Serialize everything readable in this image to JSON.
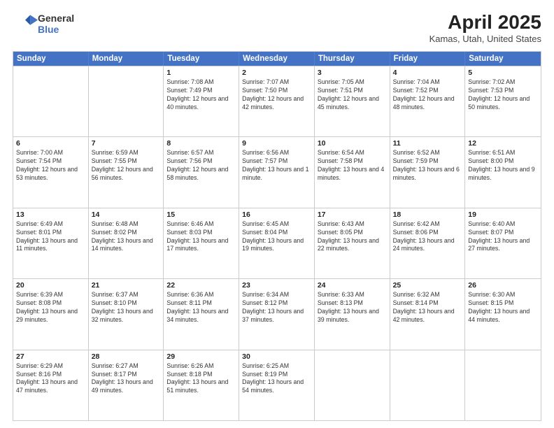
{
  "header": {
    "logo_general": "General",
    "logo_blue": "Blue",
    "month_year": "April 2025",
    "location": "Kamas, Utah, United States"
  },
  "days_of_week": [
    "Sunday",
    "Monday",
    "Tuesday",
    "Wednesday",
    "Thursday",
    "Friday",
    "Saturday"
  ],
  "weeks": [
    [
      {
        "day": "",
        "info": ""
      },
      {
        "day": "",
        "info": ""
      },
      {
        "day": "1",
        "info": "Sunrise: 7:08 AM\nSunset: 7:49 PM\nDaylight: 12 hours and 40 minutes."
      },
      {
        "day": "2",
        "info": "Sunrise: 7:07 AM\nSunset: 7:50 PM\nDaylight: 12 hours and 42 minutes."
      },
      {
        "day": "3",
        "info": "Sunrise: 7:05 AM\nSunset: 7:51 PM\nDaylight: 12 hours and 45 minutes."
      },
      {
        "day": "4",
        "info": "Sunrise: 7:04 AM\nSunset: 7:52 PM\nDaylight: 12 hours and 48 minutes."
      },
      {
        "day": "5",
        "info": "Sunrise: 7:02 AM\nSunset: 7:53 PM\nDaylight: 12 hours and 50 minutes."
      }
    ],
    [
      {
        "day": "6",
        "info": "Sunrise: 7:00 AM\nSunset: 7:54 PM\nDaylight: 12 hours and 53 minutes."
      },
      {
        "day": "7",
        "info": "Sunrise: 6:59 AM\nSunset: 7:55 PM\nDaylight: 12 hours and 56 minutes."
      },
      {
        "day": "8",
        "info": "Sunrise: 6:57 AM\nSunset: 7:56 PM\nDaylight: 12 hours and 58 minutes."
      },
      {
        "day": "9",
        "info": "Sunrise: 6:56 AM\nSunset: 7:57 PM\nDaylight: 13 hours and 1 minute."
      },
      {
        "day": "10",
        "info": "Sunrise: 6:54 AM\nSunset: 7:58 PM\nDaylight: 13 hours and 4 minutes."
      },
      {
        "day": "11",
        "info": "Sunrise: 6:52 AM\nSunset: 7:59 PM\nDaylight: 13 hours and 6 minutes."
      },
      {
        "day": "12",
        "info": "Sunrise: 6:51 AM\nSunset: 8:00 PM\nDaylight: 13 hours and 9 minutes."
      }
    ],
    [
      {
        "day": "13",
        "info": "Sunrise: 6:49 AM\nSunset: 8:01 PM\nDaylight: 13 hours and 11 minutes."
      },
      {
        "day": "14",
        "info": "Sunrise: 6:48 AM\nSunset: 8:02 PM\nDaylight: 13 hours and 14 minutes."
      },
      {
        "day": "15",
        "info": "Sunrise: 6:46 AM\nSunset: 8:03 PM\nDaylight: 13 hours and 17 minutes."
      },
      {
        "day": "16",
        "info": "Sunrise: 6:45 AM\nSunset: 8:04 PM\nDaylight: 13 hours and 19 minutes."
      },
      {
        "day": "17",
        "info": "Sunrise: 6:43 AM\nSunset: 8:05 PM\nDaylight: 13 hours and 22 minutes."
      },
      {
        "day": "18",
        "info": "Sunrise: 6:42 AM\nSunset: 8:06 PM\nDaylight: 13 hours and 24 minutes."
      },
      {
        "day": "19",
        "info": "Sunrise: 6:40 AM\nSunset: 8:07 PM\nDaylight: 13 hours and 27 minutes."
      }
    ],
    [
      {
        "day": "20",
        "info": "Sunrise: 6:39 AM\nSunset: 8:08 PM\nDaylight: 13 hours and 29 minutes."
      },
      {
        "day": "21",
        "info": "Sunrise: 6:37 AM\nSunset: 8:10 PM\nDaylight: 13 hours and 32 minutes."
      },
      {
        "day": "22",
        "info": "Sunrise: 6:36 AM\nSunset: 8:11 PM\nDaylight: 13 hours and 34 minutes."
      },
      {
        "day": "23",
        "info": "Sunrise: 6:34 AM\nSunset: 8:12 PM\nDaylight: 13 hours and 37 minutes."
      },
      {
        "day": "24",
        "info": "Sunrise: 6:33 AM\nSunset: 8:13 PM\nDaylight: 13 hours and 39 minutes."
      },
      {
        "day": "25",
        "info": "Sunrise: 6:32 AM\nSunset: 8:14 PM\nDaylight: 13 hours and 42 minutes."
      },
      {
        "day": "26",
        "info": "Sunrise: 6:30 AM\nSunset: 8:15 PM\nDaylight: 13 hours and 44 minutes."
      }
    ],
    [
      {
        "day": "27",
        "info": "Sunrise: 6:29 AM\nSunset: 8:16 PM\nDaylight: 13 hours and 47 minutes."
      },
      {
        "day": "28",
        "info": "Sunrise: 6:27 AM\nSunset: 8:17 PM\nDaylight: 13 hours and 49 minutes."
      },
      {
        "day": "29",
        "info": "Sunrise: 6:26 AM\nSunset: 8:18 PM\nDaylight: 13 hours and 51 minutes."
      },
      {
        "day": "30",
        "info": "Sunrise: 6:25 AM\nSunset: 8:19 PM\nDaylight: 13 hours and 54 minutes."
      },
      {
        "day": "",
        "info": ""
      },
      {
        "day": "",
        "info": ""
      },
      {
        "day": "",
        "info": ""
      }
    ]
  ]
}
